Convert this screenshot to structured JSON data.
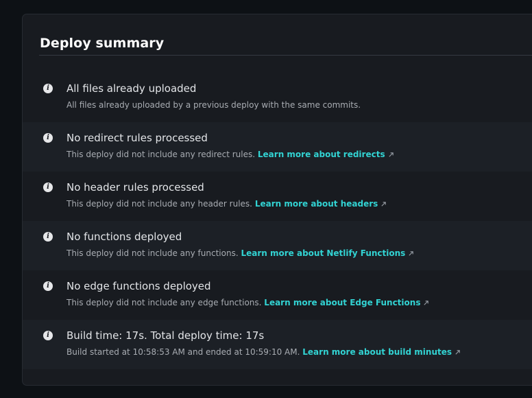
{
  "card": {
    "title": "Deploy summary"
  },
  "items": [
    {
      "icon": "info-icon",
      "title": "All files already uploaded",
      "description": "All files already uploaded by a previous deploy with the same commits.",
      "link": ""
    },
    {
      "icon": "info-icon",
      "title": "No redirect rules processed",
      "description": "This deploy did not include any redirect rules.",
      "link": "Learn more about redirects"
    },
    {
      "icon": "info-icon",
      "title": "No header rules processed",
      "description": "This deploy did not include any header rules.",
      "link": "Learn more about headers"
    },
    {
      "icon": "info-icon",
      "title": "No functions deployed",
      "description": "This deploy did not include any functions.",
      "link": "Learn more about Netlify Functions"
    },
    {
      "icon": "info-icon",
      "title": "No edge functions deployed",
      "description": "This deploy did not include any edge functions.",
      "link": "Learn more about Edge Functions"
    },
    {
      "icon": "info-icon",
      "title": "Build time: 17s. Total deploy time: 17s",
      "description": "Build started at 10:58:53 AM and ended at 10:59:10 AM.",
      "link": "Learn more about build minutes"
    }
  ],
  "colors": {
    "background": "#0d1115",
    "card": "#181b20",
    "link": "#32d3d3"
  }
}
